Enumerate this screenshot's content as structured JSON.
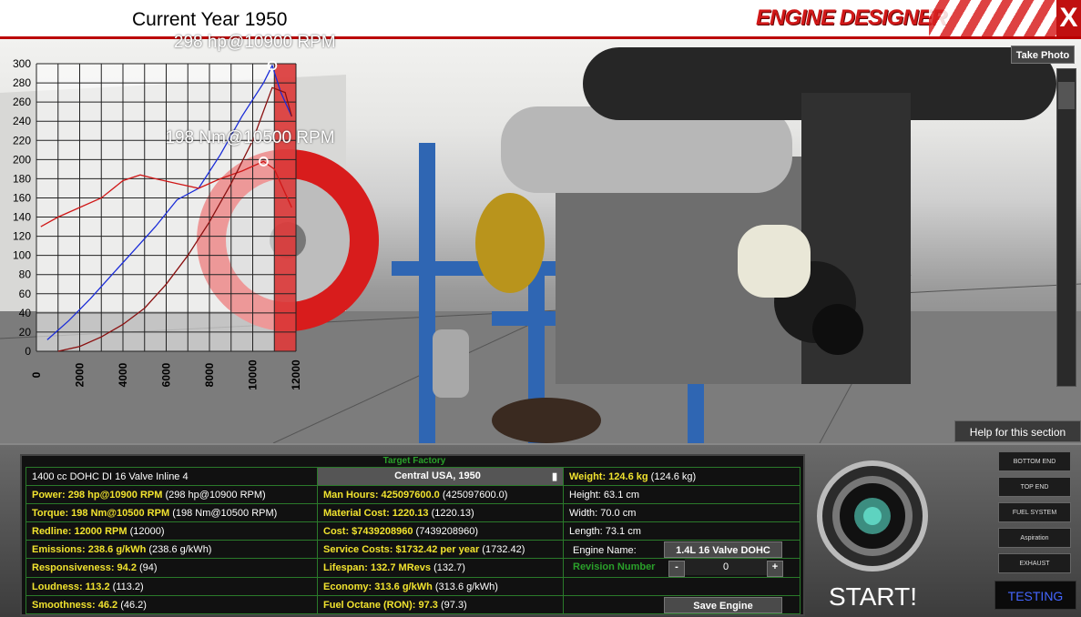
{
  "header": {
    "current_year": "Current Year 1950",
    "title": "ENGINE DESIGNER",
    "close_label": "X"
  },
  "viewport": {
    "take_photo_label": "Take Photo",
    "help_label": "Help for this section"
  },
  "chart_data": {
    "type": "line",
    "title": "",
    "xlabel": "",
    "ylabel": "",
    "xlim": [
      0,
      12000
    ],
    "ylim": [
      0,
      300
    ],
    "x_ticks": [
      "0",
      "2000",
      "4000",
      "6000",
      "8000",
      "10000",
      "12000"
    ],
    "y_ticks": [
      "0",
      "20",
      "40",
      "60",
      "80",
      "100",
      "120",
      "140",
      "160",
      "180",
      "200",
      "220",
      "240",
      "260",
      "280",
      "300"
    ],
    "grid": true,
    "redline_from": 11000,
    "series": [
      {
        "name": "",
        "color": "#1a2cd8",
        "x": [
          500,
          1500,
          2500,
          3500,
          4500,
          5500,
          6500,
          7500,
          8500,
          9500,
          10500,
          10900,
          11300,
          11800
        ],
        "y": [
          12,
          32,
          55,
          80,
          105,
          130,
          158,
          170,
          205,
          245,
          280,
          298,
          270,
          245
        ]
      },
      {
        "name": "",
        "color": "#d01818",
        "x": [
          200,
          1000,
          2000,
          3000,
          4000,
          4800,
          5500,
          6500,
          7500,
          8500,
          9500,
          10500,
          11000,
          11500,
          11800
        ],
        "y": [
          130,
          140,
          150,
          160,
          178,
          184,
          180,
          175,
          170,
          180,
          188,
          198,
          190,
          165,
          150
        ]
      },
      {
        "name": "",
        "color": "#8a1010",
        "x": [
          1000,
          2000,
          3000,
          4000,
          5000,
          6000,
          7000,
          8000,
          9000,
          10000,
          10900,
          11500,
          11800
        ],
        "y": [
          0,
          5,
          15,
          28,
          45,
          70,
          100,
          135,
          175,
          220,
          275,
          270,
          245
        ]
      }
    ],
    "annotations": [
      {
        "text": "298 hp@10900 RPM",
        "x": 10900,
        "y": 298
      },
      {
        "text": "198 Nm@10500 RPM",
        "x": 10500,
        "y": 198
      }
    ]
  },
  "stats": {
    "target_label": "Target Factory",
    "engine_desc": "1400 cc DOHC DI 16 Valve Inline 4",
    "factory_select": "Central USA, 1950",
    "col1": [
      {
        "label": "Power: 298 hp@10900 RPM",
        "value": "(298 hp@10900 RPM)"
      },
      {
        "label": "Torque: 198 Nm@10500 RPM",
        "value": "(198 Nm@10500 RPM)"
      },
      {
        "label": "Redline: 12000 RPM",
        "value": "(12000)"
      },
      {
        "label": "Emissions: 238.6 g/kWh",
        "value": "(238.6 g/kWh)"
      },
      {
        "label": "Responsiveness: 94.2",
        "value": "(94)"
      },
      {
        "label": "Loudness: 113.2",
        "value": "(113.2)"
      },
      {
        "label": "Smoothness: 46.2",
        "value": "(46.2)"
      }
    ],
    "col2": [
      {
        "label": "Man Hours: 425097600.0",
        "value": "(425097600.0)"
      },
      {
        "label": "Material Cost: 1220.13",
        "value": "(1220.13)"
      },
      {
        "label": "Cost: $7439208960",
        "value": "(7439208960)"
      },
      {
        "label": "Service Costs: $1732.42 per year",
        "value": "(1732.42)"
      },
      {
        "label": "Lifespan: 132.7 MRevs",
        "value": "(132.7)"
      },
      {
        "label": "Economy: 313.6 g/kWh",
        "value": "(313.6 g/kWh)"
      },
      {
        "label": "Fuel Octane (RON): 97.3",
        "value": "(97.3)"
      }
    ],
    "weight_label": "Weight: 124.6 kg",
    "weight_value": "(124.6 kg)",
    "height": "Height: 63.1 cm",
    "width": "Width: 70.0 cm",
    "length": "Length: 73.1 cm",
    "engine_name_label": "Engine Name:",
    "engine_name_value": "1.4L 16 Valve DOHC",
    "revision_label": "Revision Number",
    "revision_minus": "-",
    "revision_value": "0",
    "revision_plus": "+",
    "save_label": "Save Engine"
  },
  "start_label": "START!",
  "nav": {
    "items": [
      "BOTTOM END",
      "TOP END",
      "FUEL SYSTEM",
      "Aspiration",
      "EXHAUST"
    ],
    "testing_label": "TESTING"
  }
}
